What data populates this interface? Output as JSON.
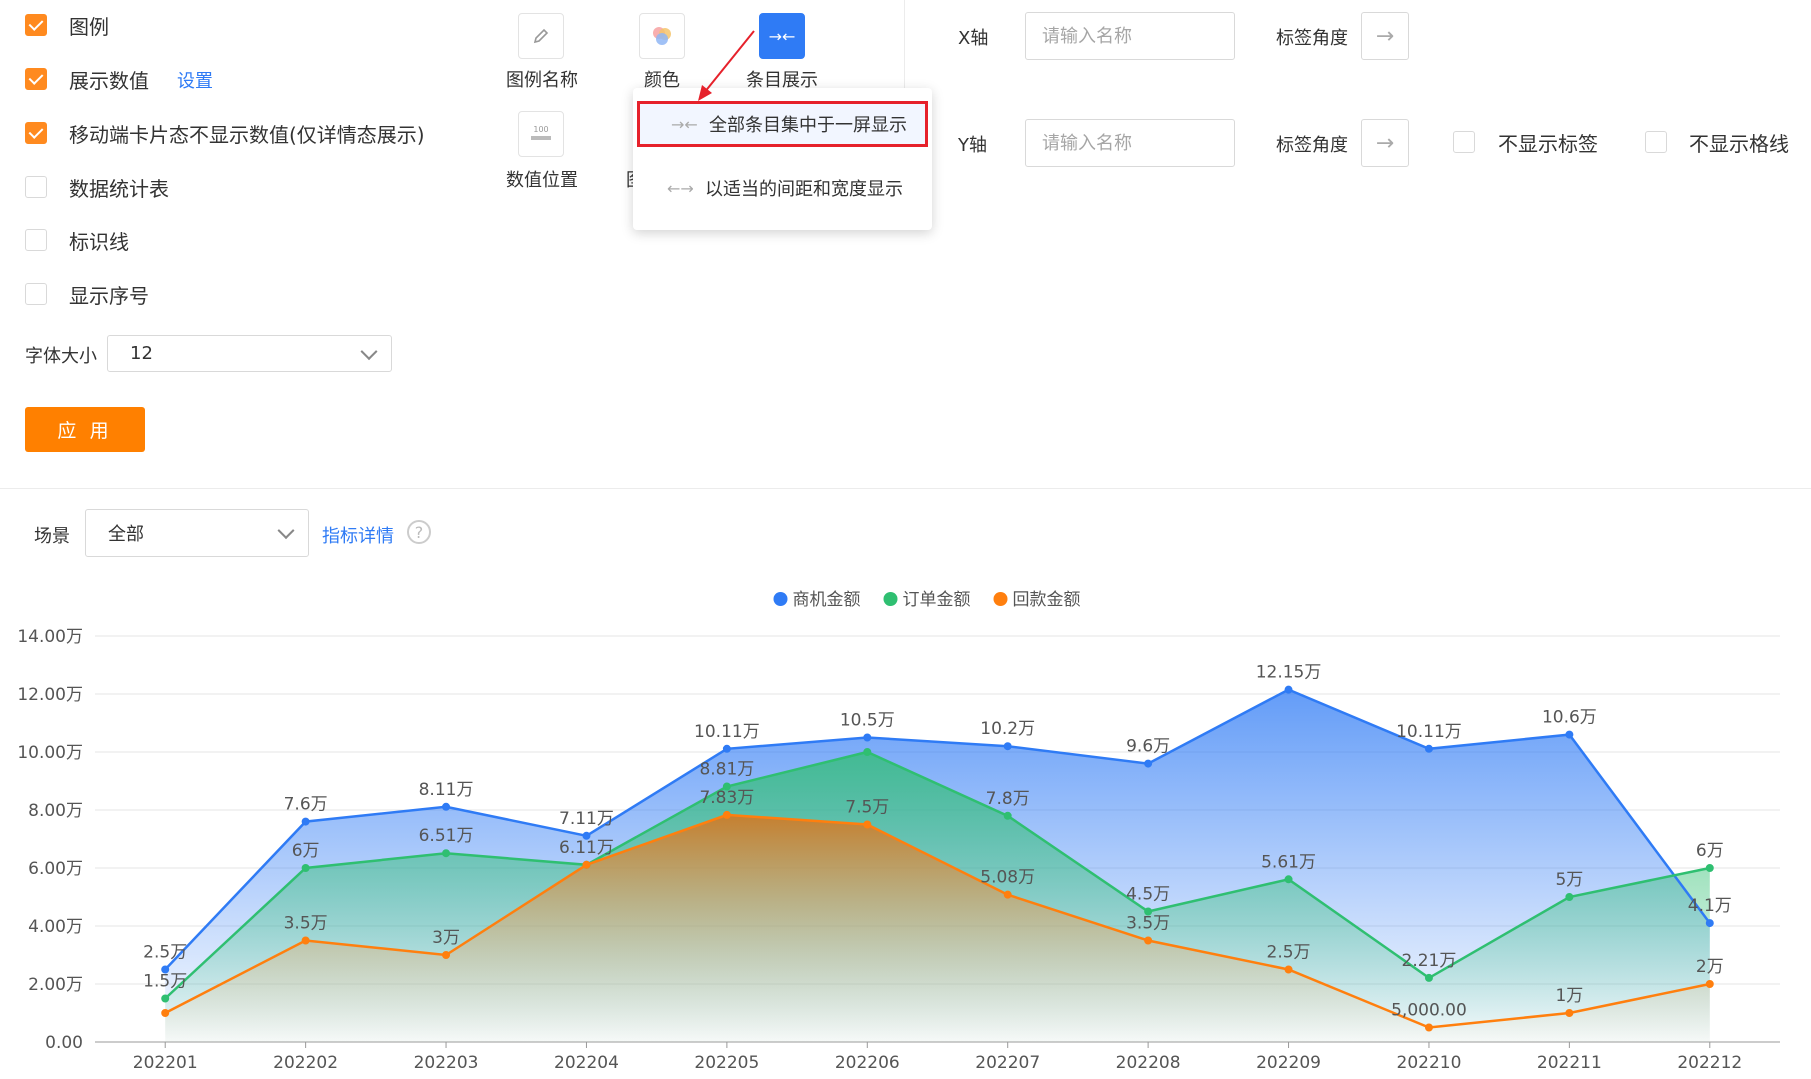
{
  "options": [
    {
      "label": "图例",
      "checked": true
    },
    {
      "label": "展示数值",
      "checked": true
    },
    {
      "label": "移动端卡片态不显示数值(仅详情态展示)",
      "checked": true
    },
    {
      "label": "数据统计表",
      "checked": false
    },
    {
      "label": "标识线",
      "checked": false
    },
    {
      "label": "显示序号",
      "checked": false
    }
  ],
  "settings_link": "设置",
  "font_size": {
    "label": "字体大小",
    "value": "12"
  },
  "apply_label": "应 用",
  "tools": {
    "legend_name": "图例名称",
    "color": "颜色",
    "item_display": "条目展示",
    "value_position": "数值位置",
    "hidden_partial": "图"
  },
  "dropdown": {
    "items": [
      {
        "icon": "→←",
        "label": "全部条目集中于一屏显示",
        "selected": true
      },
      {
        "icon": "←→",
        "label": "以适当的间距和宽度显示",
        "selected": false
      }
    ]
  },
  "axis": {
    "x_label": "X轴",
    "y_label": "Y轴",
    "name_placeholder": "请输入名称",
    "tag_angle": "标签角度",
    "hide_labels": "不显示标签",
    "hide_grid": "不显示格线"
  },
  "scene": {
    "label": "场景",
    "value": "全部",
    "detail_link": "指标详情",
    "help": "?"
  },
  "colors": {
    "accent": "#ff8000",
    "blue": "#2f7bf5",
    "green": "#2fbf71",
    "orange": "#ff7f0e"
  },
  "chart_data": {
    "type": "area",
    "categories": [
      "202201",
      "202202",
      "202203",
      "202204",
      "202205",
      "202206",
      "202207",
      "202208",
      "202209",
      "202210",
      "202211",
      "202212"
    ],
    "ylim": [
      0,
      14
    ],
    "yticks": [
      "0.00",
      "2.00万",
      "4.00万",
      "6.00万",
      "8.00万",
      "10.00万",
      "12.00万",
      "14.00万"
    ],
    "legend_position": "top-center",
    "grid": true,
    "series": [
      {
        "name": "商机金额",
        "color": "#2f7bf5",
        "values": [
          2.5,
          7.6,
          8.11,
          7.11,
          10.11,
          10.5,
          10.2,
          9.6,
          12.15,
          10.11,
          10.6,
          4.1
        ],
        "labels": [
          "2.5万",
          "7.6万",
          "8.11万",
          "7.11万",
          "10.11万",
          "10.5万",
          "10.2万",
          "9.6万",
          "12.15万",
          "10.11万",
          "10.6万",
          "4.1万"
        ]
      },
      {
        "name": "订单金额",
        "color": "#2fbf71",
        "values": [
          1.5,
          6,
          6.51,
          6.11,
          8.81,
          10,
          7.8,
          4.5,
          5.61,
          2.21,
          5,
          6
        ],
        "labels": [
          "1.5万",
          "6万",
          "6.51万",
          "6.11万",
          "8.81万",
          "",
          "7.8万",
          "4.5万",
          "5.61万",
          "2.21万",
          "5万",
          "6万"
        ]
      },
      {
        "name": "回款金额",
        "color": "#ff7f0e",
        "values": [
          1,
          3.5,
          3,
          6.11,
          7.83,
          7.5,
          5.08,
          3.5,
          2.5,
          0.5,
          1,
          2
        ],
        "labels": [
          "",
          "3.5万",
          "3万",
          "",
          "7.83万",
          "7.5万",
          "5.08万",
          "3.5万",
          "2.5万",
          "5,000.00",
          "1万",
          "2万"
        ]
      }
    ]
  }
}
